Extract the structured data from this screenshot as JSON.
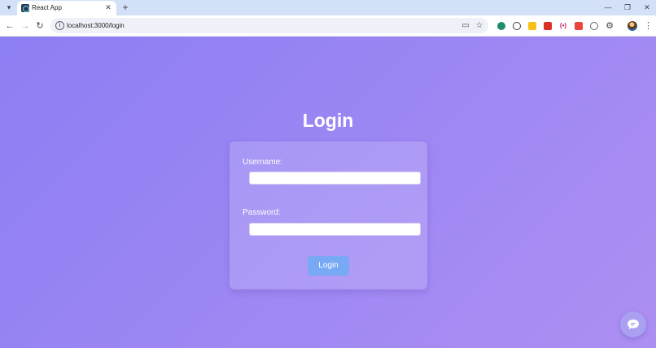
{
  "browser": {
    "tab": {
      "title": "React App"
    },
    "address_bar": {
      "url": "localhost:3000/login"
    },
    "icons": {
      "tab_search": "chevron-down-icon",
      "tab_close": "close-icon",
      "new_tab": "plus-icon",
      "back": "arrow-left-icon",
      "forward": "arrow-right-icon",
      "reload": "reload-icon",
      "site_info": "info-icon",
      "install": "install-app-icon",
      "bookmark": "star-icon",
      "extensions": "puzzle-icon",
      "menu": "kebab-menu-icon"
    },
    "extension_colors": [
      "#1e8e6e",
      "#3c4043",
      "#f6c21a",
      "#d93025",
      "#c2185b",
      "#e8453c",
      "#5f6368"
    ]
  },
  "page": {
    "title": "Login",
    "username": {
      "label": "Username:",
      "value": "",
      "placeholder": ""
    },
    "password": {
      "label": "Password:",
      "value": "",
      "placeholder": ""
    },
    "submit_label": "Login",
    "chat_icon": "chat-bubble-icon",
    "colors": {
      "background_start": "#8c7ef3",
      "background_end": "#ad8ff3",
      "button": "#78a9f5"
    }
  }
}
